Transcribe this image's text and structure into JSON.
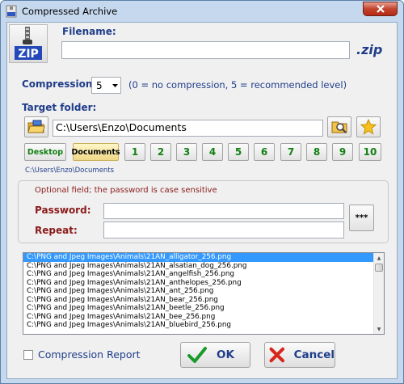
{
  "window": {
    "title": "Compressed Archive"
  },
  "filename": {
    "label": "Filename:",
    "value": "",
    "extension": ".zip"
  },
  "compression": {
    "label": "Compression:",
    "selected": "5",
    "hint": "(0 = no compression, 5 = recommended level)"
  },
  "target": {
    "label": "Target folder:",
    "path": "C:\\Users\\Enzo\\Documents",
    "current_path": "C:\\Users\\Enzo\\Documents"
  },
  "quick_folders": {
    "named": [
      "Desktop",
      "Documents"
    ],
    "numbered": [
      "1",
      "2",
      "3",
      "4",
      "5",
      "6",
      "7",
      "8",
      "9",
      "10"
    ]
  },
  "password": {
    "notice": "Optional field; the password is case sensitive",
    "password_label": "Password:",
    "repeat_label": "Repeat:",
    "password_value": "",
    "repeat_value": "",
    "show_label": "***"
  },
  "files": [
    "C:\\PNG and Jpeg Images\\Animals\\21AN_alligator_256.png",
    "C:\\PNG and Jpeg Images\\Animals\\21AN_alsatian_dog_256.png",
    "C:\\PNG and Jpeg Images\\Animals\\21AN_angelfish_256.png",
    "C:\\PNG and Jpeg Images\\Animals\\21AN_anthelopes_256.png",
    "C:\\PNG and Jpeg Images\\Animals\\21AN_ant_256.png",
    "C:\\PNG and Jpeg Images\\Animals\\21AN_bear_256.png",
    "C:\\PNG and Jpeg Images\\Animals\\21AN_beetle_256.png",
    "C:\\PNG and Jpeg Images\\Animals\\21AN_bee_256.png",
    "C:\\PNG and Jpeg Images\\Animals\\21AN_bluebird_256.png"
  ],
  "report": {
    "label": "Compression Report",
    "checked": false
  },
  "buttons": {
    "ok": "OK",
    "cancel": "Cancel"
  },
  "colors": {
    "accent_blue": "#1f3d8a",
    "accent_red": "#8b1a1a",
    "quick_green": "#138013",
    "selection": "#3399ff"
  }
}
